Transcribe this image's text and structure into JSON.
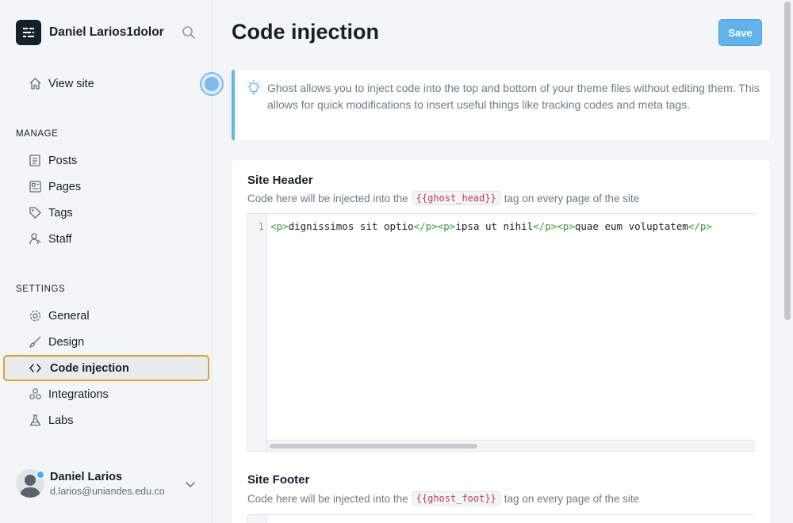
{
  "brand": {
    "site_name": "Daniel Larios1dolor"
  },
  "nav": {
    "view_site": "View site",
    "manage_label": "MANAGE",
    "manage_items": [
      "Posts",
      "Pages",
      "Tags",
      "Staff"
    ],
    "settings_label": "SETTINGS",
    "settings_items": [
      "General",
      "Design",
      "Code injection",
      "Integrations",
      "Labs"
    ],
    "active": "Code injection"
  },
  "user": {
    "name": "Daniel Larios",
    "email": "d.larios@uniandes.edu.co"
  },
  "page": {
    "title": "Code injection",
    "save_label": "Save"
  },
  "info": {
    "text": "Ghost allows you to inject code into the top and bottom of your theme files without editing them. This allows for quick modifications to insert useful things like tracking codes and meta tags."
  },
  "header_field": {
    "title": "Site Header",
    "desc_before": "Code here will be injected into the",
    "tag": "{{ghost_head}}",
    "desc_after": "tag on every page of the site",
    "line_number": "1",
    "code": [
      {
        "t": "tag",
        "v": "<p>"
      },
      {
        "t": "text",
        "v": "dignissimos sit optio"
      },
      {
        "t": "tag",
        "v": "</p><p>"
      },
      {
        "t": "text",
        "v": "ipsa ut nihil"
      },
      {
        "t": "tag",
        "v": "</p><p>"
      },
      {
        "t": "text",
        "v": "quae eum voluptatem"
      },
      {
        "t": "tag",
        "v": "</p>"
      }
    ]
  },
  "footer_field": {
    "title": "Site Footer",
    "desc_before": "Code here will be injected into the",
    "tag": "{{ghost_foot}}",
    "desc_after": "tag on every page of the site"
  },
  "colors": {
    "accent": "#62b3eb",
    "active_border": "#d9a23a",
    "code_tag": "#3a9a3a",
    "handlebars": "#c13d54"
  }
}
